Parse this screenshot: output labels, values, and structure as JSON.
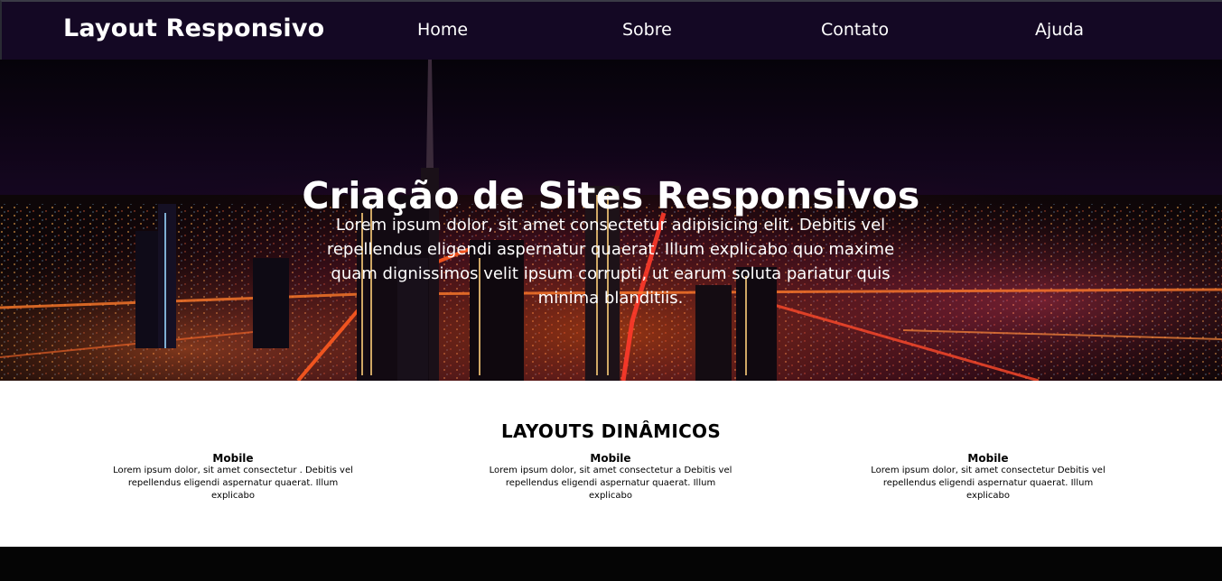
{
  "nav": {
    "brand": "Layout Responsivo",
    "items": [
      "Home",
      "Sobre",
      "Contato",
      "Ajuda"
    ]
  },
  "hero": {
    "title": "Criação de Sites Responsivos",
    "text": "Lorem ipsum dolor, sit amet consectetur adipisicing elit. Debitis vel repellendus eligendi aspernatur quaerat. Illum explicabo quo maxime quam dignissimos velit ipsum corrupti, ut earum soluta pariatur quis minima blanditiis."
  },
  "features": {
    "heading": "LAYOUTS DINÂMICOS",
    "cards": [
      {
        "title": "Mobile",
        "text": "Lorem ipsum dolor, sit amet consectetur . Debitis vel repellendus eligendi aspernatur quaerat. Illum explicabo"
      },
      {
        "title": "Mobile",
        "text": "Lorem ipsum dolor, sit amet consectetur a Debitis vel repellendus eligendi aspernatur quaerat. Illum explicabo"
      },
      {
        "title": "Mobile",
        "text": "Lorem ipsum dolor, sit amet consectetur Debitis vel repellendus eligendi aspernatur quaerat. Illum explicabo"
      }
    ]
  },
  "colors": {
    "navbar_bg": "#140824",
    "hero_sky": "#050208",
    "city_lights": "#ff6a1a",
    "text_light": "#ffffff",
    "text_dark": "#000000"
  }
}
